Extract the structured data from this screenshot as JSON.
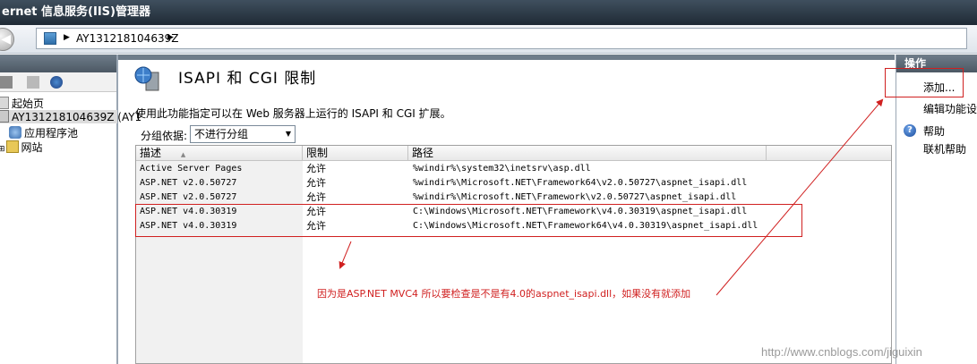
{
  "window": {
    "title": "ernet 信息服务(IIS)管理器"
  },
  "address": {
    "path": "AY131218104639Z"
  },
  "tree": {
    "items": [
      {
        "label": "起始页"
      },
      {
        "label": "AY131218104639Z (AY1"
      },
      {
        "label": "应用程序池"
      },
      {
        "label": "网站"
      }
    ]
  },
  "feature": {
    "title": "ISAPI 和 CGI 限制",
    "description": "使用此功能指定可以在 Web 服务器上运行的 ISAPI 和 CGI 扩展。",
    "groupby_label": "分组依据:",
    "groupby_value": "不进行分组"
  },
  "grid": {
    "columns": [
      "描述",
      "限制",
      "路径"
    ],
    "rows": [
      {
        "desc": "Active Server Pages",
        "restriction": "允许",
        "path": "%windir%\\system32\\inetsrv\\asp.dll"
      },
      {
        "desc": "ASP.NET v2.0.50727",
        "restriction": "允许",
        "path": "%windir%\\Microsoft.NET\\Framework64\\v2.0.50727\\aspnet_isapi.dll"
      },
      {
        "desc": "ASP.NET v2.0.50727",
        "restriction": "允许",
        "path": "%windir%\\Microsoft.NET\\Framework\\v2.0.50727\\aspnet_isapi.dll"
      },
      {
        "desc": "ASP.NET v4.0.30319",
        "restriction": "允许",
        "path": "C:\\Windows\\Microsoft.NET\\Framework\\v4.0.30319\\aspnet_isapi.dll"
      },
      {
        "desc": "ASP.NET v4.0.30319",
        "restriction": "允许",
        "path": "C:\\Windows\\Microsoft.NET\\Framework64\\v4.0.30319\\aspnet_isapi.dll"
      }
    ]
  },
  "annotation": {
    "text": "因为是ASP.NET MVC4 所以要检查是不是有4.0的aspnet_isapi.dll，如果没有就添加"
  },
  "actions": {
    "header": "操作",
    "add": "添加...",
    "edit_settings": "编辑功能设",
    "help": "帮助",
    "online_help": "联机帮助"
  },
  "watermark": "http://www.cnblogs.com/jiguixin",
  "colors": {
    "annotation": "#d02020",
    "header_band": "#5e6b78"
  }
}
